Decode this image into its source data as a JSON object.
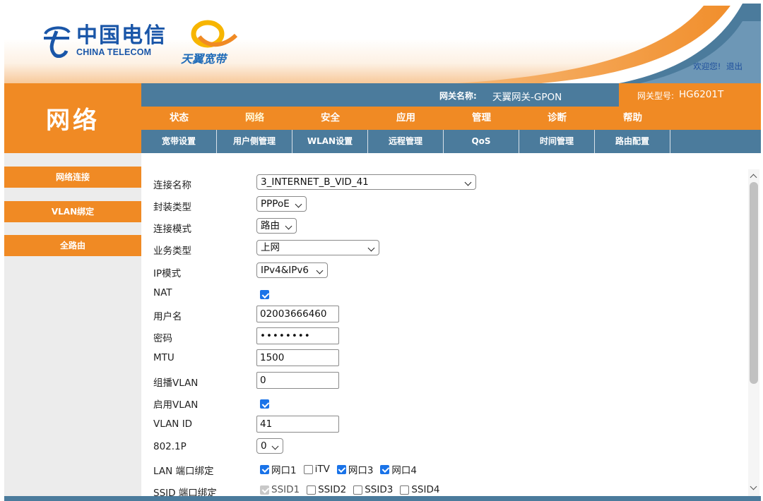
{
  "header": {
    "brand_cn": "中国电信",
    "brand_en": "CHINA TELECOM",
    "product": "天翼宽带",
    "welcome": "欢迎您!",
    "logout": "退出"
  },
  "section_title": "网络",
  "info": {
    "gateway_name_label": "网关名称:",
    "gateway_name": "天翼网关-GPON",
    "gateway_model_label": "网关型号:",
    "gateway_model": "HG6201T"
  },
  "main_nav": [
    {
      "label": "状态"
    },
    {
      "label": "网络"
    },
    {
      "label": "安全"
    },
    {
      "label": "应用"
    },
    {
      "label": "管理"
    },
    {
      "label": "诊断"
    },
    {
      "label": "帮助"
    }
  ],
  "sub_nav": [
    {
      "label": "宽带设置"
    },
    {
      "label": "用户侧管理"
    },
    {
      "label": "WLAN设置"
    },
    {
      "label": "远程管理"
    },
    {
      "label": "QoS"
    },
    {
      "label": "时间管理"
    },
    {
      "label": "路由配置"
    }
  ],
  "sidebar": [
    {
      "label": "网络连接"
    },
    {
      "label": "VLAN绑定"
    },
    {
      "label": "全路由"
    }
  ],
  "form": {
    "connection_name": {
      "label": "连接名称",
      "value": "3_INTERNET_B_VID_41"
    },
    "encapsulation": {
      "label": "封装类型",
      "value": "PPPoE"
    },
    "connection_mode": {
      "label": "连接模式",
      "value": "路由"
    },
    "service_type": {
      "label": "业务类型",
      "value": "上网"
    },
    "ip_mode": {
      "label": "IP模式",
      "value": "IPv4&IPv6"
    },
    "nat": {
      "label": "NAT",
      "checked": true
    },
    "username": {
      "label": "用户名",
      "value": "02003666460"
    },
    "password": {
      "label": "密码",
      "value": "••••••••"
    },
    "mtu": {
      "label": "MTU",
      "value": "1500"
    },
    "multicast_vlan": {
      "label": "组播VLAN",
      "value": "0"
    },
    "enable_vlan": {
      "label": "启用VLAN",
      "checked": true
    },
    "vlan_id": {
      "label": "VLAN ID",
      "value": "41"
    },
    "dot1p": {
      "label": "802.1P",
      "value": "0"
    },
    "lan_binding": {
      "label": "LAN 端口绑定",
      "options": [
        {
          "label": "网口1",
          "state": "on"
        },
        {
          "label": "iTV",
          "state": "off"
        },
        {
          "label": "网口3",
          "state": "on"
        },
        {
          "label": "网口4",
          "state": "on"
        }
      ]
    },
    "ssid_binding": {
      "label": "SSID 端口绑定",
      "options": [
        {
          "label": "SSID1",
          "state": "dis"
        },
        {
          "label": "SSID2",
          "state": "off"
        },
        {
          "label": "SSID3",
          "state": "off"
        },
        {
          "label": "SSID4",
          "state": "off"
        }
      ]
    }
  },
  "colors": {
    "orange": "#f08a24",
    "steel_blue": "#4b7b9c",
    "brand_blue": "#1a56a8",
    "checkbox_blue": "#1a73e8"
  }
}
